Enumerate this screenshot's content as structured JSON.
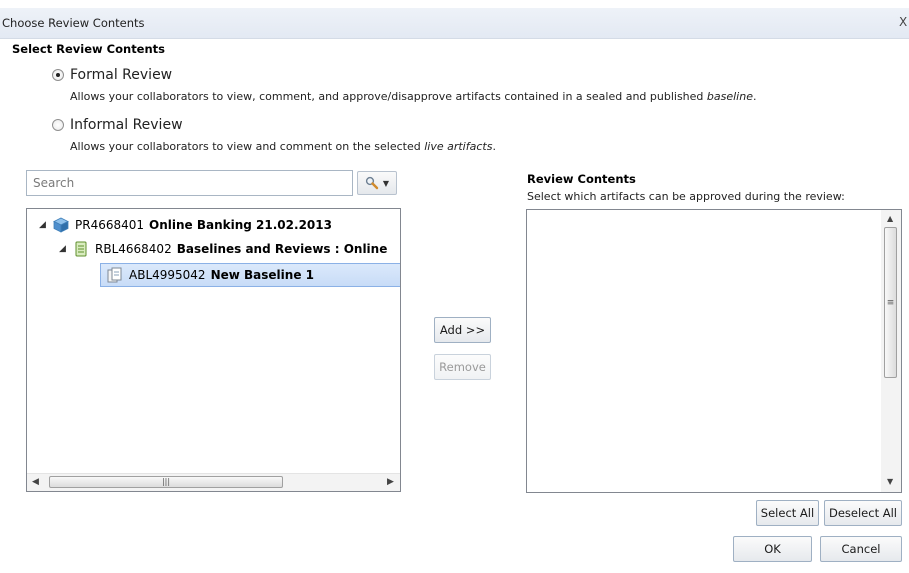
{
  "window": {
    "title": "Choose Review Contents",
    "close_label": "X"
  },
  "section_title": "Select Review Contents",
  "review_types": [
    {
      "label": "Formal Review",
      "selected": true,
      "desc_prefix": "Allows your collaborators to view, comment, and approve/disapprove artifacts contained in a sealed and published ",
      "desc_em": "baseline",
      "desc_suffix": "."
    },
    {
      "label": "Informal Review",
      "selected": false,
      "desc_prefix": "Allows your collaborators to view and comment on the selected ",
      "desc_em": "live artifacts",
      "desc_suffix": "."
    }
  ],
  "search": {
    "placeholder": "Search",
    "value": ""
  },
  "tree": {
    "items": [
      {
        "id": "PR4668401",
        "name": "Online Banking 21.02.2013",
        "icon": "project-cube-icon",
        "expanded": true
      },
      {
        "id": "RBL4668402",
        "name": "Baselines and Reviews : Online",
        "icon": "baseline-folder-icon",
        "expanded": true
      },
      {
        "id": "ABL4995042",
        "name": "New Baseline 1",
        "icon": "baseline-doc-icon",
        "selected": true
      }
    ]
  },
  "buttons": {
    "add": "Add >>",
    "remove": "Remove",
    "select_all": "Select All",
    "deselect_all": "Deselect All",
    "ok": "OK",
    "cancel": "Cancel"
  },
  "review_contents": {
    "title": "Review Contents",
    "desc": "Select which artifacts can be approved during the review:"
  },
  "colors": {
    "title_bar": "#e6ecf5",
    "selection": "#cfe0f8",
    "selection_border": "#8bb1e6",
    "project_icon": "#5a9bd5",
    "baseline_icon": "#7fb04a"
  }
}
